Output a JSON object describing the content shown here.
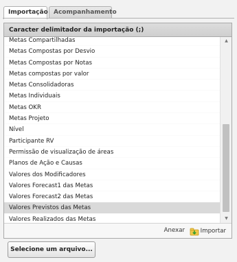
{
  "tabs": [
    {
      "label": "Importação",
      "active": true
    },
    {
      "label": "Acompanhamento",
      "active": false
    }
  ],
  "panel": {
    "title": "Caracter delimitador da importação (;)",
    "items": [
      "Metas Compartilhadas",
      "Metas Compostas por Desvio",
      "Metas Compostas por Notas",
      "Metas compostas por valor",
      "Metas Consolidadoras",
      "Metas Individuais",
      "Metas OKR",
      "Metas Projeto",
      "Nível",
      "Participante RV",
      "Permissão de visualização de áreas",
      "Planos de Ação e Causas",
      "Valores dos Modificadores",
      "Valores Forecast1 das Metas",
      "Valores Forecast2 das Metas",
      "Valores Previstos das Metas",
      "Valores Realizados das Metas"
    ],
    "selected_item": "Valores Previstos das Metas"
  },
  "footer": {
    "attach_label": "Anexar",
    "import_label": "Importar"
  },
  "file_button": {
    "label": "Selecione um arquivo..."
  },
  "icons": {
    "scroll_up": "chevron-up-icon",
    "scroll_down": "chevron-down-icon",
    "import": "import-icon"
  }
}
